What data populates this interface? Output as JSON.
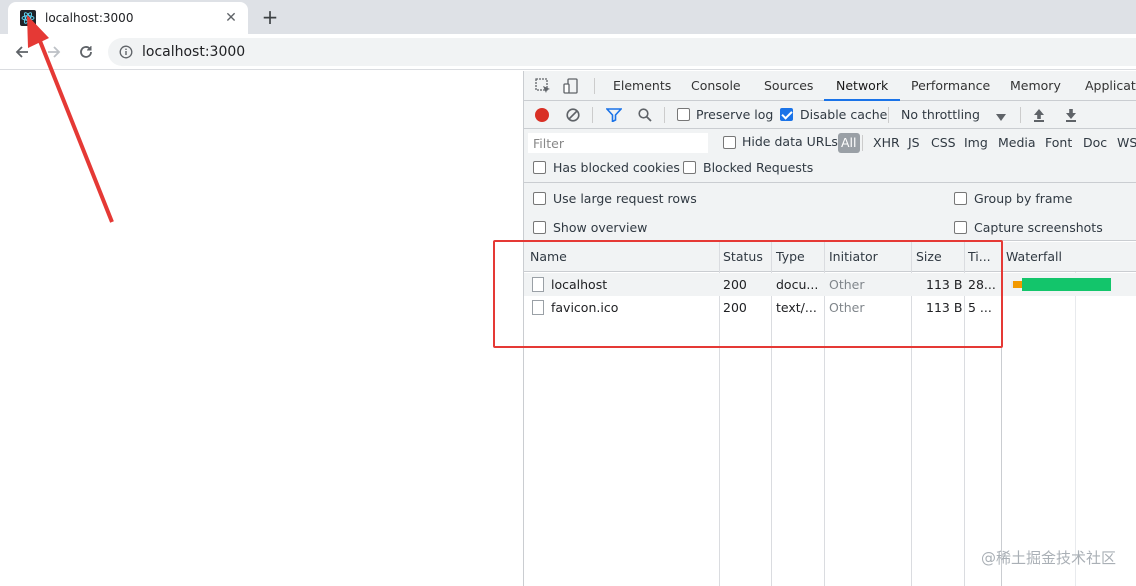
{
  "browser": {
    "tab_title": "localhost:3000",
    "tab_close": "✕",
    "new_tab": "+",
    "url": "localhost:3000"
  },
  "devtools": {
    "tabs": [
      "Elements",
      "Console",
      "Sources",
      "Network",
      "Performance",
      "Memory",
      "Applicati"
    ],
    "active_tab": "Network",
    "toolbar": {
      "preserve_log": "Preserve log",
      "disable_cache": "Disable cache",
      "throttling": "No throttling"
    },
    "filter": {
      "placeholder": "Filter",
      "hide_data_urls": "Hide data URLs",
      "types": [
        "All",
        "XHR",
        "JS",
        "CSS",
        "Img",
        "Media",
        "Font",
        "Doc",
        "WS"
      ],
      "has_blocked_cookies": "Has blocked cookies",
      "blocked_requests": "Blocked Requests"
    },
    "settings": {
      "large_rows": "Use large request rows",
      "group_by_frame": "Group by frame",
      "show_overview": "Show overview",
      "capture_screenshots": "Capture screenshots"
    },
    "table": {
      "headers": [
        "Name",
        "Status",
        "Type",
        "Initiator",
        "Size",
        "Ti...",
        "Waterfall"
      ],
      "rows": [
        {
          "name": "localhost",
          "status": "200",
          "type": "docu...",
          "initiator": "Other",
          "size": "113 B",
          "time": "28..."
        },
        {
          "name": "favicon.ico",
          "status": "200",
          "type": "text/...",
          "initiator": "Other",
          "size": "113 B",
          "time": "5 ..."
        }
      ]
    }
  },
  "watermark": "@稀土掘金技术社区",
  "colors": {
    "accent": "#1a73e8",
    "record": "#d93025",
    "annotation": "#e53935",
    "waterfall": "#13c56b"
  }
}
